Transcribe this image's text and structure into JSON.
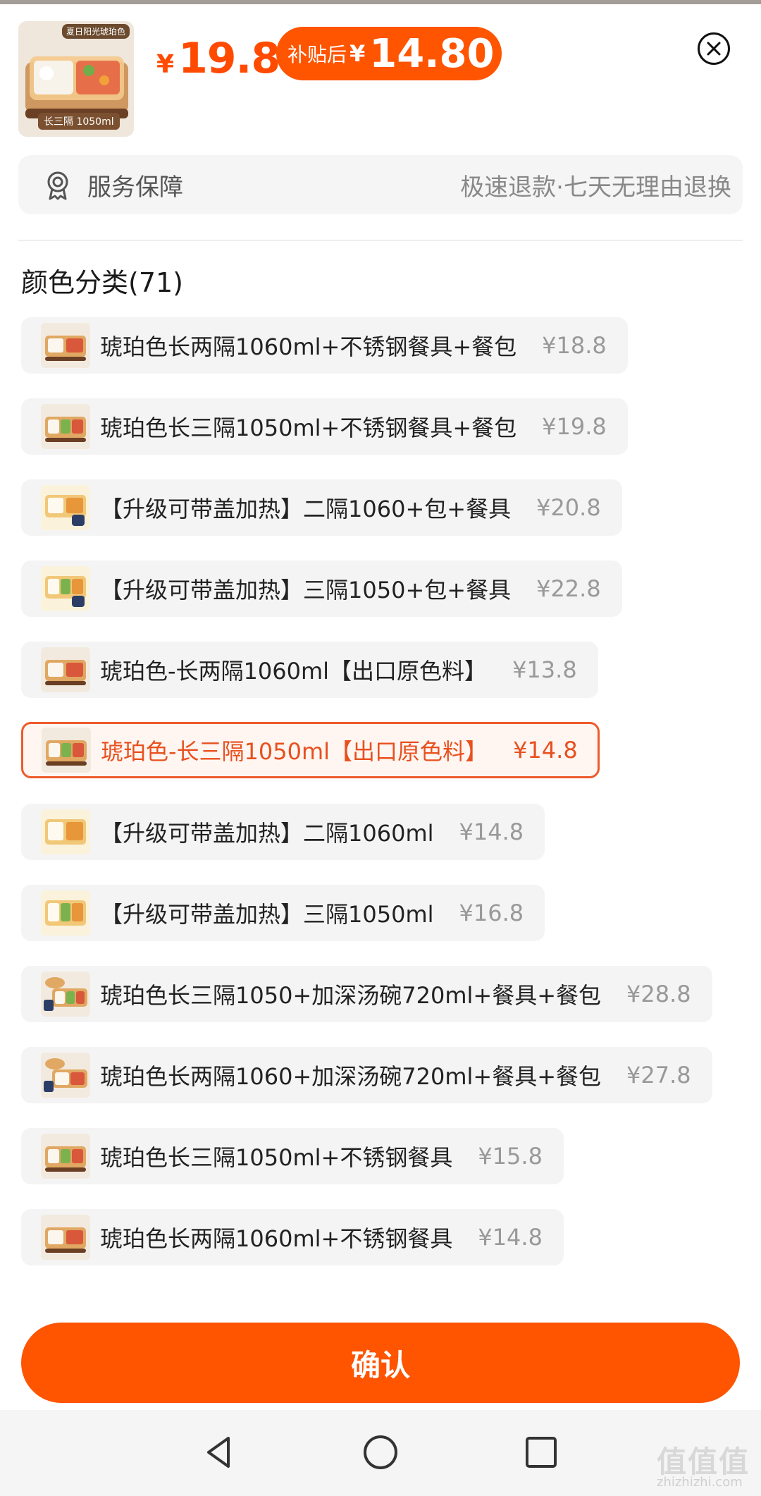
{
  "header": {
    "thumb_tag_top": "夏日阳光琥珀色",
    "thumb_tag_bottom": "长三隔 1050ml",
    "currency": "¥",
    "price": "19.8",
    "subsidy_label": "补贴后",
    "subsidy_currency": "¥",
    "subsidy_price": "14.80"
  },
  "service": {
    "title": "服务保障",
    "description": "极速退款·七天无理由退换"
  },
  "section_title": "颜色分类(71)",
  "options": [
    {
      "name": "琥珀色长两隔1060ml+不锈钢餐具+餐包",
      "price": "¥18.8",
      "selected": false
    },
    {
      "name": "琥珀色长三隔1050ml+不锈钢餐具+餐包",
      "price": "¥19.8",
      "selected": false
    },
    {
      "name": "【升级可带盖加热】二隔1060+包+餐具",
      "price": "¥20.8",
      "selected": false
    },
    {
      "name": "【升级可带盖加热】三隔1050+包+餐具",
      "price": "¥22.8",
      "selected": false
    },
    {
      "name": "琥珀色-长两隔1060ml【出口原色料】",
      "price": "¥13.8",
      "selected": false
    },
    {
      "name": "琥珀色-长三隔1050ml【出口原色料】",
      "price": "¥14.8",
      "selected": true
    },
    {
      "name": "【升级可带盖加热】二隔1060ml",
      "price": "¥14.8",
      "selected": false
    },
    {
      "name": "【升级可带盖加热】三隔1050ml",
      "price": "¥16.8",
      "selected": false
    },
    {
      "name": "琥珀色长三隔1050+加深汤碗720ml+餐具+餐包",
      "price": "¥28.8",
      "selected": false
    },
    {
      "name": "琥珀色长两隔1060+加深汤碗720ml+餐具+餐包",
      "price": "¥27.8",
      "selected": false
    },
    {
      "name": "琥珀色长三隔1050ml+不锈钢餐具",
      "price": "¥15.8",
      "selected": false
    },
    {
      "name": "琥珀色长两隔1060ml+不锈钢餐具",
      "price": "¥14.8",
      "selected": false
    }
  ],
  "confirm_label": "确认",
  "watermark": "值值值",
  "watermark_url": "zhizhizhi.com",
  "colors": {
    "accent": "#ff5400",
    "selected_border": "#ee5a2b",
    "selected_text": "#e8501e"
  }
}
